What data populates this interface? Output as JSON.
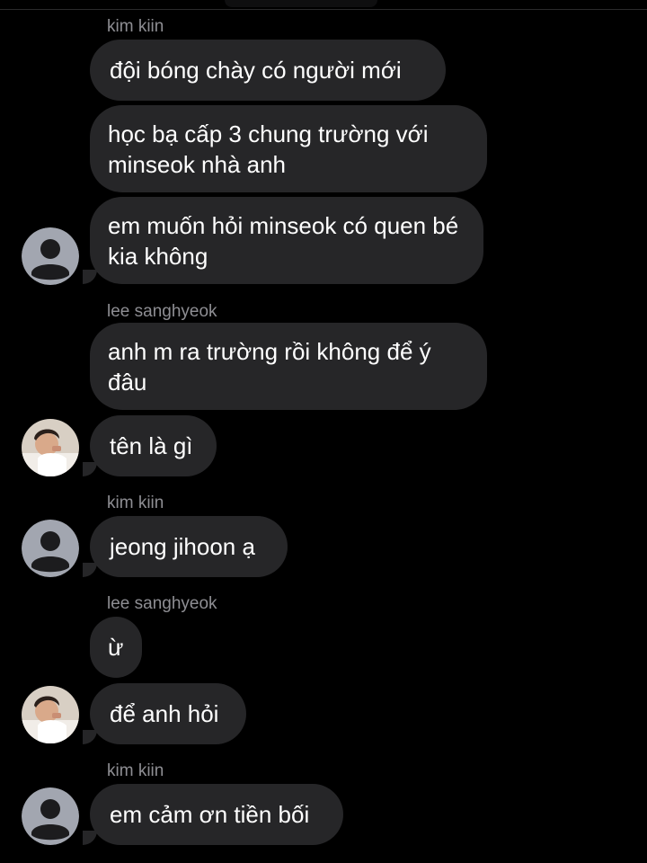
{
  "participants": {
    "kim_kiin": "kim kiin",
    "lee_sanghyeok": "lee sanghyeok"
  },
  "avatars": {
    "default": "default-user-avatar-icon",
    "photo": "profile-photo"
  },
  "colors": {
    "background": "#000000",
    "bubble": "#262628",
    "sender_name": "#8e8e93",
    "text": "#ffffff"
  },
  "messages": [
    {
      "sender": "kim kiin",
      "text": "đội bóng chày có người mới"
    },
    {
      "text": "học bạ cấp 3 chung trường với minseok nhà anh"
    },
    {
      "text": "em muốn hỏi minseok có quen bé kia không"
    },
    {
      "sender": "lee sanghyeok",
      "text": "anh m ra trường rồi không để ý đâu"
    },
    {
      "text": "tên là gì"
    },
    {
      "sender": "kim kiin",
      "text": "jeong jihoon ạ"
    },
    {
      "sender": "lee sanghyeok",
      "text": "ừ"
    },
    {
      "text": "để anh hỏi"
    },
    {
      "sender": "kim kiin",
      "text": "em cảm ơn tiền bối"
    }
  ]
}
